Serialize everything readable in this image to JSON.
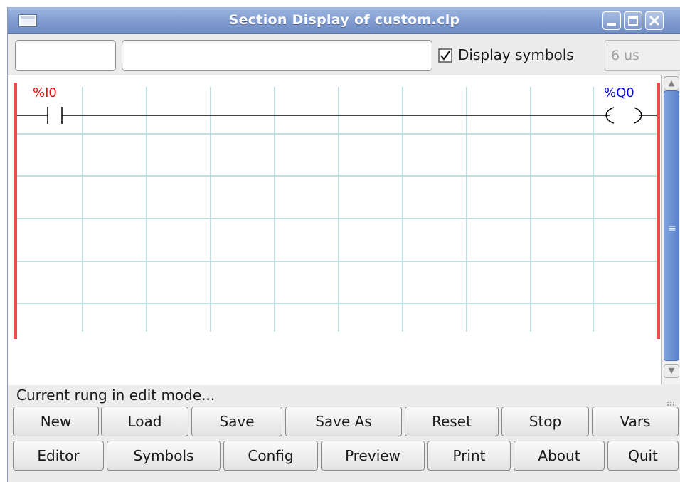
{
  "window": {
    "title": "Section Display of custom.clp"
  },
  "toolbar": {
    "field1_value": "",
    "field2_value": "",
    "display_symbols_label": "Display symbols",
    "display_symbols_checked": true,
    "scan_time": "6 us"
  },
  "ladder": {
    "contact_label": "%I0",
    "coil_label": "%Q0",
    "contact_color": "#ff0000",
    "coil_color": "#0000ff",
    "rail_color": "#f04a4a",
    "grid_color": "#a9d6d8"
  },
  "status": {
    "text": "Current rung in edit mode..."
  },
  "buttons": {
    "row1": [
      "New",
      "Load",
      "Save",
      "Save As",
      "Reset",
      "Stop",
      "Vars"
    ],
    "row2": [
      "Editor",
      "Symbols",
      "Config",
      "Preview",
      "Print",
      "About",
      "Quit"
    ]
  }
}
